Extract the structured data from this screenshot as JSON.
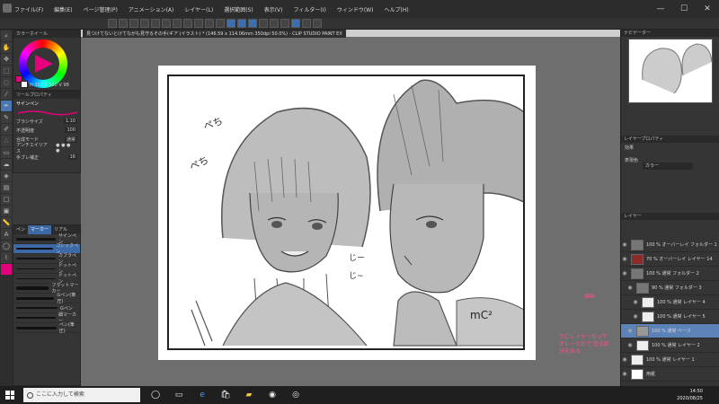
{
  "menu": [
    "ファイル(F)",
    "編集(E)",
    "ページ管理(P)",
    "アニメーション(A)",
    "レイヤー(L)",
    "選択範囲(S)",
    "表示(V)",
    "フィルター(I)",
    "ウィンドウ(W)",
    "ヘルプ(H)"
  ],
  "window_title": "見つけてないとけてながも見守るその手(ギア (イラスト) * (146.59 x 114.06mm 350dpi 50.0%) - CLIP STUDIO PAINT EX",
  "color_panel": {
    "title": "カラーホイール",
    "values": "H 350 S 100 V 98",
    "main_color": "#e6007e"
  },
  "tool_property": {
    "title": "ツールプロパティ",
    "tool_name": "サインペン",
    "rows": [
      {
        "label": "ブラシサイズ",
        "value": "1.10"
      },
      {
        "label": "不透明度",
        "value": "100"
      },
      {
        "label": "合成モード",
        "value": "通常"
      },
      {
        "label": "アンチエイリアス",
        "value": ""
      },
      {
        "label": "手ブレ補正",
        "value": "16"
      }
    ]
  },
  "subtool": {
    "tabs": [
      "ペン",
      "マーカー",
      "リアル"
    ],
    "brushes": [
      "サインペン",
      "ゴシックペン",
      "カブラペン",
      "ドットペン",
      "ドットペン",
      "フラットマーカー",
      "Gペン(筆圧)",
      "Gペン",
      "細マーカー",
      "ペン(筆圧)"
    ]
  },
  "navigator_title": "ナビゲーター",
  "layer_property": {
    "title": "レイヤープロパティ",
    "effect_label": "効果",
    "expression_label": "表現色",
    "expression_value": "カラー"
  },
  "layers_title": "レイヤー",
  "layers": [
    {
      "name": "100 % オーバーレイ フォルダー 1"
    },
    {
      "name": "70 % オーバーレイ レイヤー 14"
    },
    {
      "name": "100 % 通常 フォルダー 2"
    },
    {
      "name": "90 % 通常 フォルダー 3"
    },
    {
      "name": "100 % 通常 レイヤー 4"
    },
    {
      "name": "100 % 通常 レイヤー 5"
    },
    {
      "name": "100 % 通常 ベース"
    },
    {
      "name": "100 % 通常 レイヤー 2"
    },
    {
      "name": "100 % 通常 レイヤー 1"
    },
    {
      "name": "用紙"
    }
  ],
  "annotations": {
    "a1": "線画",
    "a2": "下にレイヤー作って グレーとかで 塗る部分をぬる"
  },
  "canvas_sfx": {
    "s1": "ペち",
    "s2": "ペち",
    "s3": "じー",
    "s4": "じ~",
    "s5": "mC²"
  },
  "taskbar": {
    "search_placeholder": "ここに入力して検索",
    "time": "14:50",
    "date": "2020/08/25"
  }
}
